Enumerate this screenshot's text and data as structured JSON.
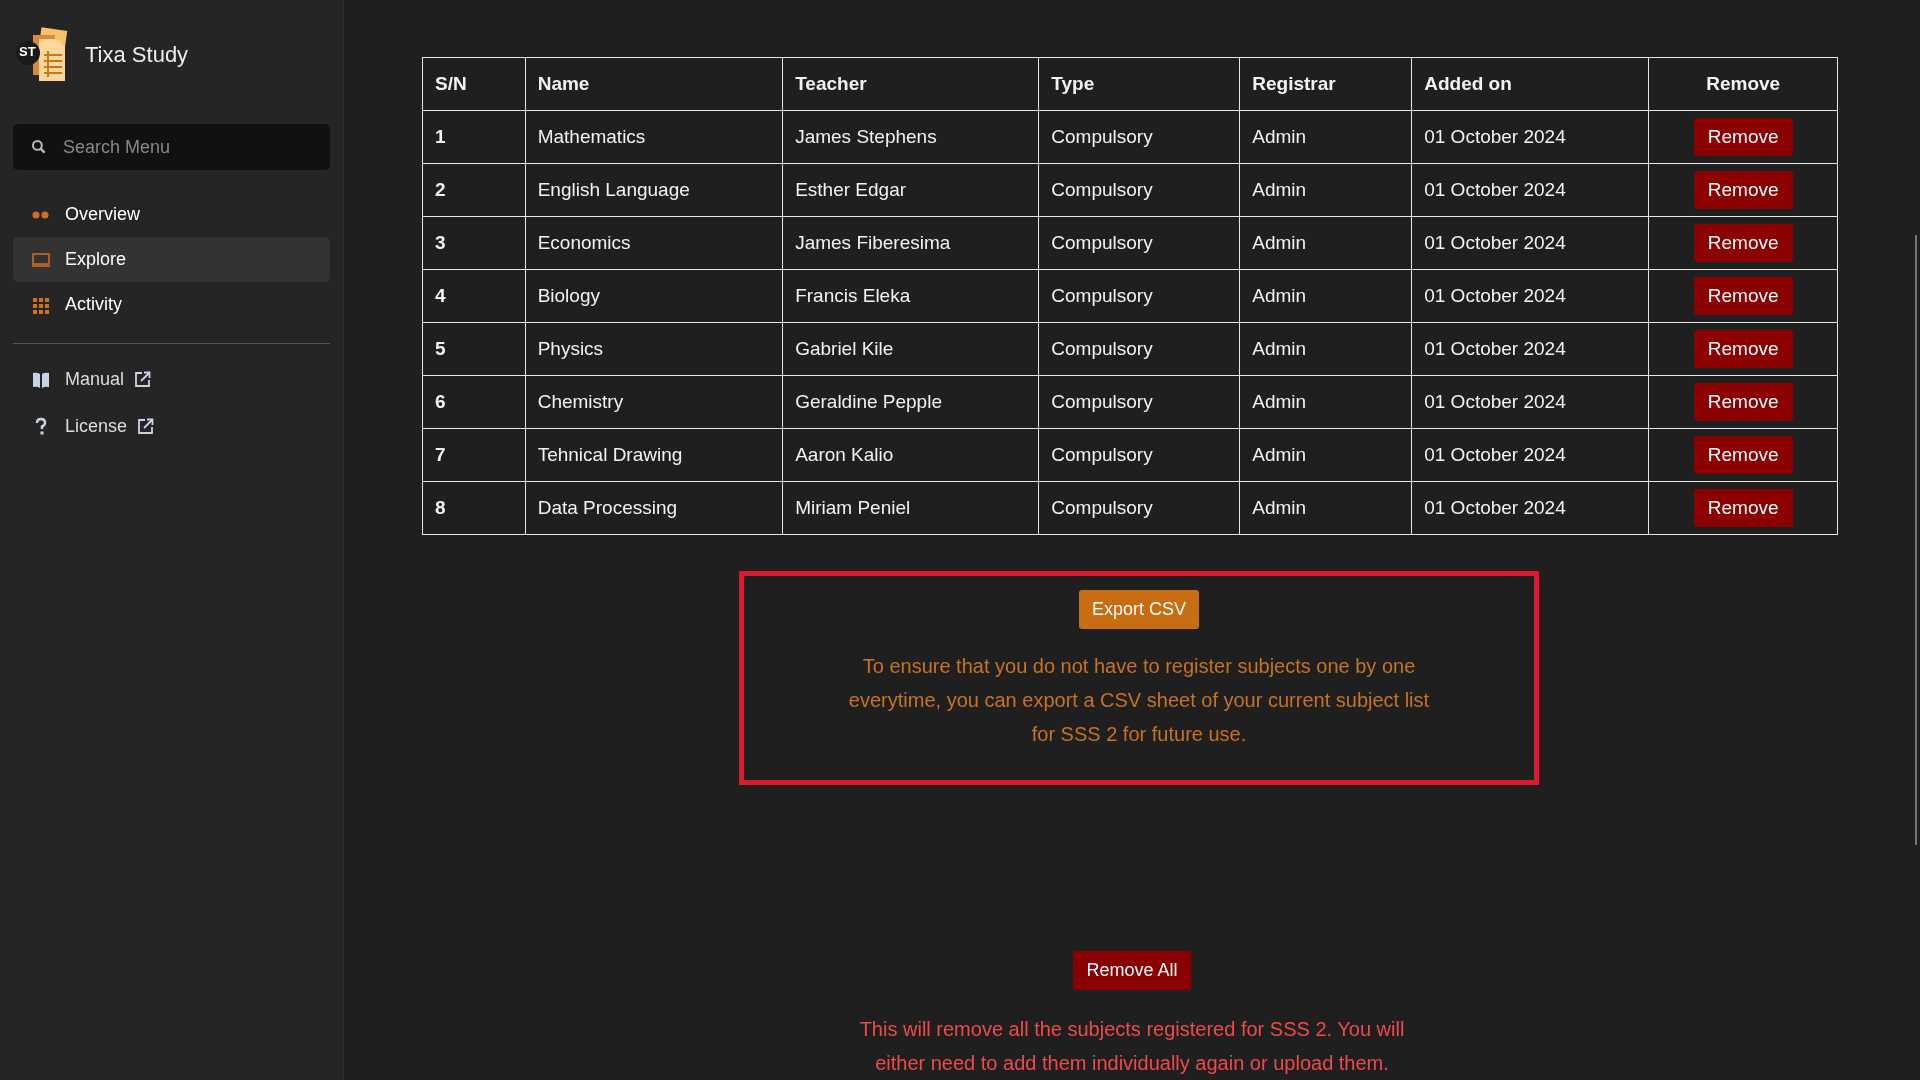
{
  "app": {
    "logo_text": "ST",
    "title": "Tixa Study"
  },
  "search": {
    "placeholder": "Search Menu"
  },
  "nav": [
    {
      "label": "Overview",
      "selected": false
    },
    {
      "label": "Explore",
      "selected": true
    },
    {
      "label": "Activity",
      "selected": false
    }
  ],
  "links": [
    {
      "label": "Manual"
    },
    {
      "label": "License"
    }
  ],
  "table": {
    "columns": [
      "S/N",
      "Name",
      "Teacher",
      "Type",
      "Registrar",
      "Added on",
      "Remove"
    ],
    "rows": [
      {
        "sn": "1",
        "name": "Mathematics",
        "teacher": "James Stephens",
        "type": "Compulsory",
        "registrar": "Admin",
        "added_on": "01 October 2024",
        "action": "Remove"
      },
      {
        "sn": "2",
        "name": "English Language",
        "teacher": "Esther Edgar",
        "type": "Compulsory",
        "registrar": "Admin",
        "added_on": "01 October 2024",
        "action": "Remove"
      },
      {
        "sn": "3",
        "name": "Economics",
        "teacher": "James Fiberesima",
        "type": "Compulsory",
        "registrar": "Admin",
        "added_on": "01 October 2024",
        "action": "Remove"
      },
      {
        "sn": "4",
        "name": "Biology",
        "teacher": "Francis Eleka",
        "type": "Compulsory",
        "registrar": "Admin",
        "added_on": "01 October 2024",
        "action": "Remove"
      },
      {
        "sn": "5",
        "name": "Physics",
        "teacher": "Gabriel Kile",
        "type": "Compulsory",
        "registrar": "Admin",
        "added_on": "01 October 2024",
        "action": "Remove"
      },
      {
        "sn": "6",
        "name": "Chemistry",
        "teacher": "Geraldine Pepple",
        "type": "Compulsory",
        "registrar": "Admin",
        "added_on": "01 October 2024",
        "action": "Remove"
      },
      {
        "sn": "7",
        "name": "Tehnical Drawing",
        "teacher": "Aaron Kalio",
        "type": "Compulsory",
        "registrar": "Admin",
        "added_on": "01 October 2024",
        "action": "Remove"
      },
      {
        "sn": "8",
        "name": "Data Processing",
        "teacher": "Miriam Peniel",
        "type": "Compulsory",
        "registrar": "Admin",
        "added_on": "01 October 2024",
        "action": "Remove"
      }
    ]
  },
  "export": {
    "button": "Export CSV",
    "note": "To ensure that you do not have to register subjects one by one everytime, you can export a CSV sheet of your current subject list for SSS 2 for future use.",
    "highlighted": true
  },
  "remove_all": {
    "button": "Remove All",
    "note": "This will remove all the subjects registered for SSS 2. You will either need to add them individually again or upload them."
  }
}
